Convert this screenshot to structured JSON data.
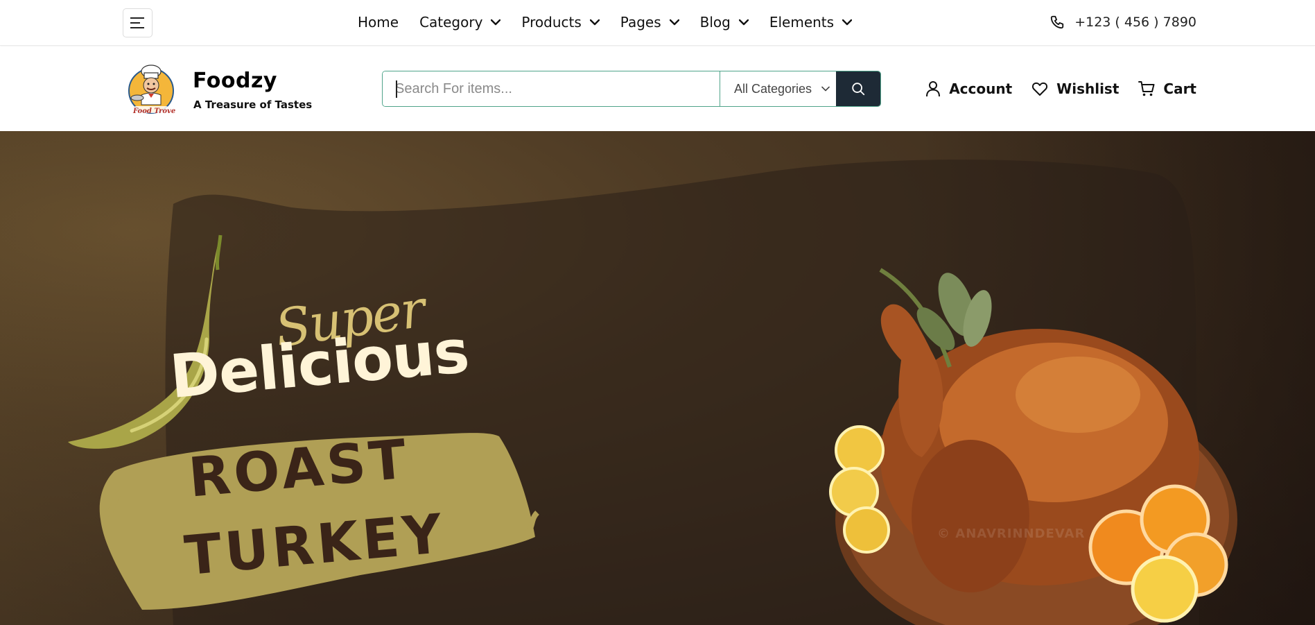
{
  "topbar": {
    "menu_icon": "hamburger-menu-icon",
    "nav": [
      {
        "label": "Home",
        "has_dropdown": false
      },
      {
        "label": "Category",
        "has_dropdown": true
      },
      {
        "label": "Products",
        "has_dropdown": true
      },
      {
        "label": "Pages",
        "has_dropdown": true
      },
      {
        "label": "Blog",
        "has_dropdown": true
      },
      {
        "label": "Elements",
        "has_dropdown": true
      }
    ],
    "phone": "+123 ( 456 ) 7890",
    "phone_icon": "phone-icon"
  },
  "header": {
    "brand_name": "Foodzy",
    "tagline": "A Treasure of Tastes",
    "logo_text": "Food Trove",
    "search": {
      "placeholder": "Search For items...",
      "value": "",
      "category": "All Categories",
      "button_icon": "search-icon"
    },
    "actions": [
      {
        "label": "Account",
        "icon": "user-icon"
      },
      {
        "label": "Wishlist",
        "icon": "heart-icon"
      },
      {
        "label": "Cart",
        "icon": "cart-icon"
      }
    ]
  },
  "hero": {
    "super": "Super",
    "delicious": "Delicious",
    "line1": "ROAST",
    "line2": "TURKEY",
    "watermark": "© ANAVRINNDEVAR",
    "colors": {
      "accent_brush": "#b09f55",
      "heading_light": "#fff4d8",
      "heading_dark": "#3a2418",
      "script": "#d7c174"
    }
  }
}
